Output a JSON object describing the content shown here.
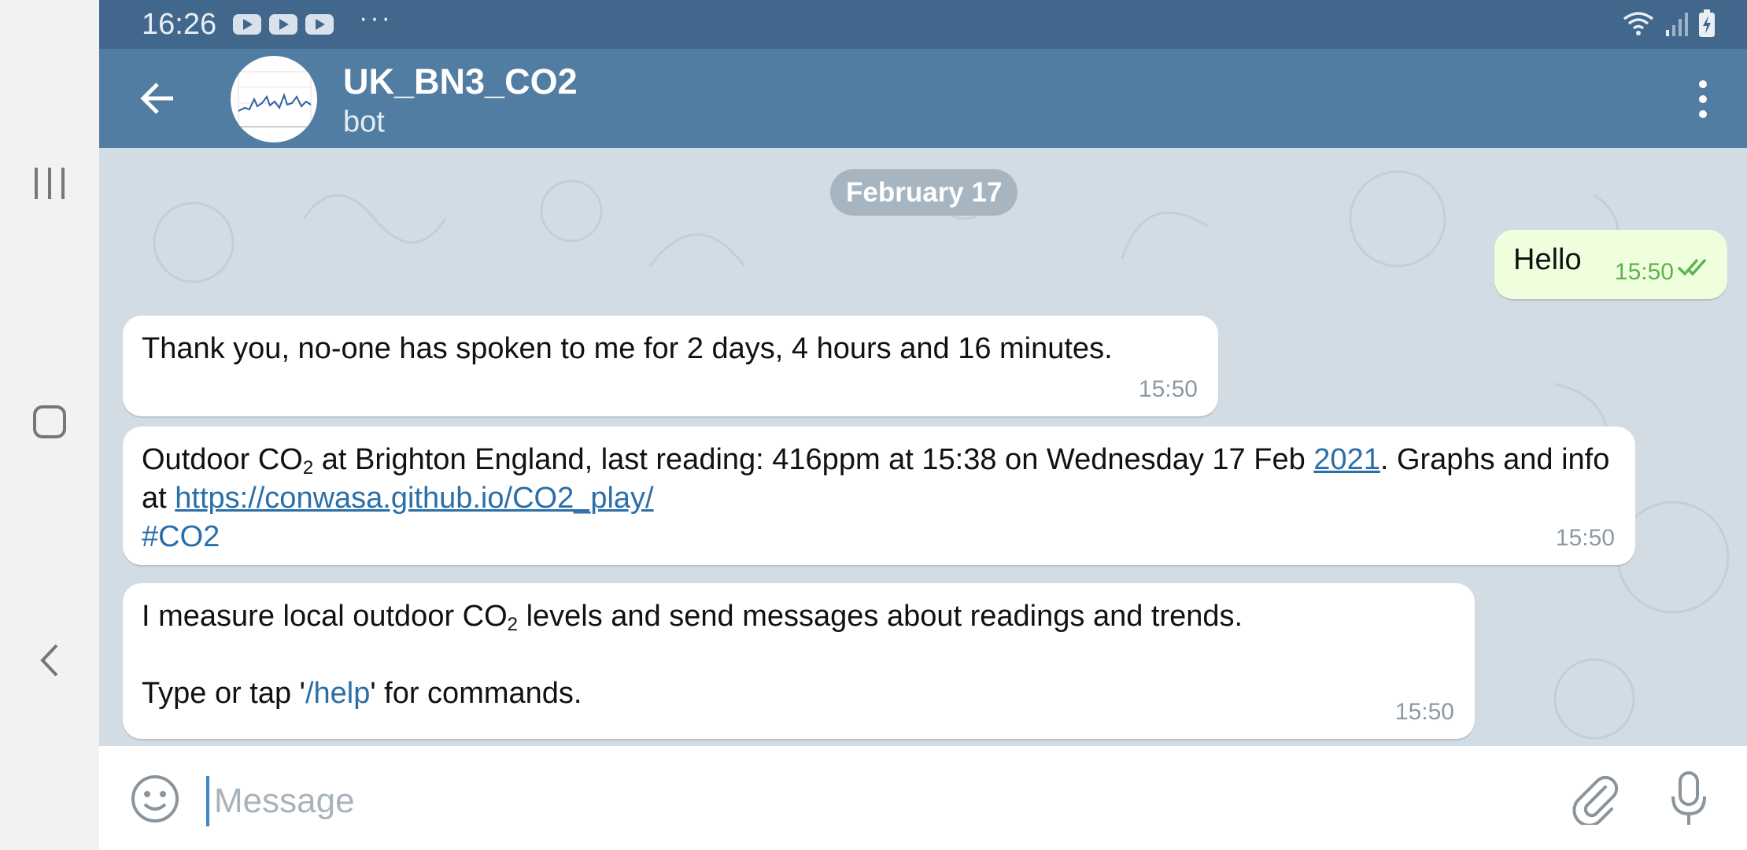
{
  "status_bar": {
    "time": "16:26",
    "more": "···",
    "icons": [
      "youtube-icon",
      "youtube-icon",
      "youtube-icon",
      "wifi-icon",
      "signal-icon",
      "battery-charging-icon"
    ]
  },
  "header": {
    "title": "UK_BN3_CO2",
    "subtitle": "bot",
    "avatar_icon": "co2-graph-avatar"
  },
  "chat": {
    "date": "February 17",
    "messages": [
      {
        "from": "me",
        "text": "Hello",
        "time": "15:50",
        "status": "read"
      },
      {
        "from": "bot",
        "text": "Thank you, no-one has spoken to me for 2 days, 4 hours and 16 minutes.",
        "time": "15:50"
      },
      {
        "from": "bot",
        "part1": "Outdoor CO",
        "sub": "2",
        "part2": " at Brighton England, last reading: 416ppm at 15:38 on Wednesday 17 Feb ",
        "link_year": "2021",
        "part3": ". Graphs and info at ",
        "link_url": "https://conwasa.github.io/CO2_play/",
        "hashtag": "#CO2",
        "time": "15:50"
      },
      {
        "from": "bot",
        "part1": "I measure local outdoor CO",
        "sub": "2",
        "part2": " levels and send messages about readings and trends.",
        "line2_pre": "Type or tap '",
        "line2_cmd": "/help",
        "line2_post": "' for commands.",
        "time": "15:50"
      }
    ]
  },
  "composer": {
    "placeholder": "Message"
  },
  "colors": {
    "status_bar": "#41678d",
    "header": "#517da2",
    "chat_bg": "#d2dce4",
    "outgoing_bubble": "#efffde",
    "link": "#2a6fa8",
    "read_check": "#5eb14c"
  }
}
